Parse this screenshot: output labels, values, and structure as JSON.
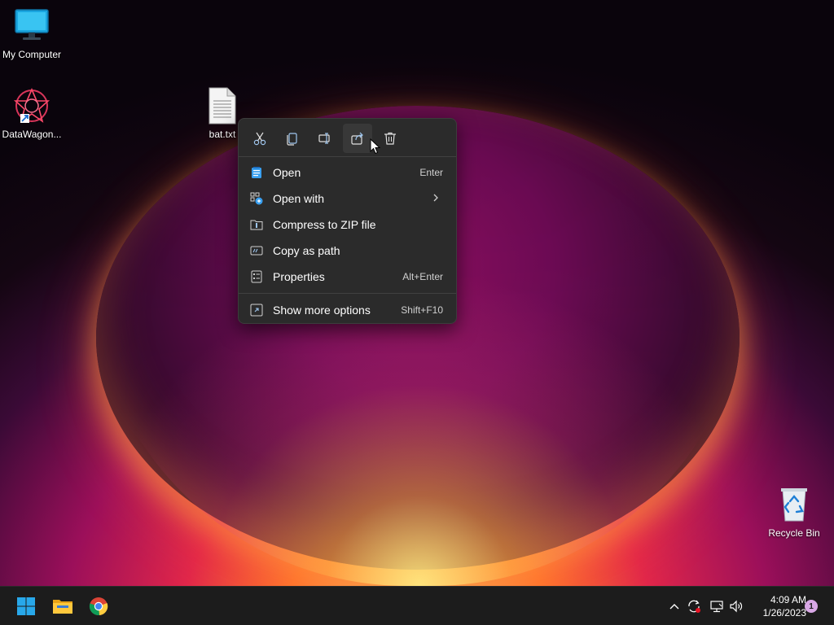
{
  "desktop": {
    "icons": [
      {
        "label": "My Computer",
        "icon": "monitor-icon"
      },
      {
        "label": "DataWagon...",
        "icon": "datawagon-app-icon"
      },
      {
        "label": "bat.txt",
        "icon": "text-file-icon"
      },
      {
        "label": "Recycle Bin",
        "icon": "recycle-bin-icon"
      }
    ]
  },
  "context_menu": {
    "toolbar": [
      {
        "name": "cut",
        "icon": "scissors-icon"
      },
      {
        "name": "copy",
        "icon": "copy-icon"
      },
      {
        "name": "rename",
        "icon": "rename-icon"
      },
      {
        "name": "share",
        "icon": "share-icon"
      },
      {
        "name": "delete",
        "icon": "trash-icon"
      }
    ],
    "items": [
      {
        "label": "Open",
        "shortcut": "Enter",
        "icon": "notepad-icon"
      },
      {
        "label": "Open with",
        "shortcut": "",
        "icon": "open-with-icon",
        "submenu": true
      },
      {
        "label": "Compress to ZIP file",
        "shortcut": "",
        "icon": "zip-folder-icon"
      },
      {
        "label": "Copy as path",
        "shortcut": "",
        "icon": "copy-path-icon"
      },
      {
        "label": "Properties",
        "shortcut": "Alt+Enter",
        "icon": "properties-icon"
      },
      {
        "label": "Show more options",
        "shortcut": "Shift+F10",
        "icon": "more-options-icon"
      }
    ],
    "submenu_arrow": ">"
  },
  "taskbar": {
    "apps": [
      {
        "name": "start",
        "icon": "windows-logo-icon"
      },
      {
        "name": "file-explorer",
        "icon": "folder-icon"
      },
      {
        "name": "chrome",
        "icon": "chrome-icon"
      }
    ],
    "tray": {
      "chevron": "^",
      "time": "4:09 AM",
      "date": "1/26/2023",
      "notification_count": "1"
    }
  },
  "colors": {
    "menu_bg": "#2b2b2b",
    "taskbar_bg": "#1c1c1c",
    "accent_blue": "#0a84ff",
    "badge": "#d9a8e6"
  }
}
